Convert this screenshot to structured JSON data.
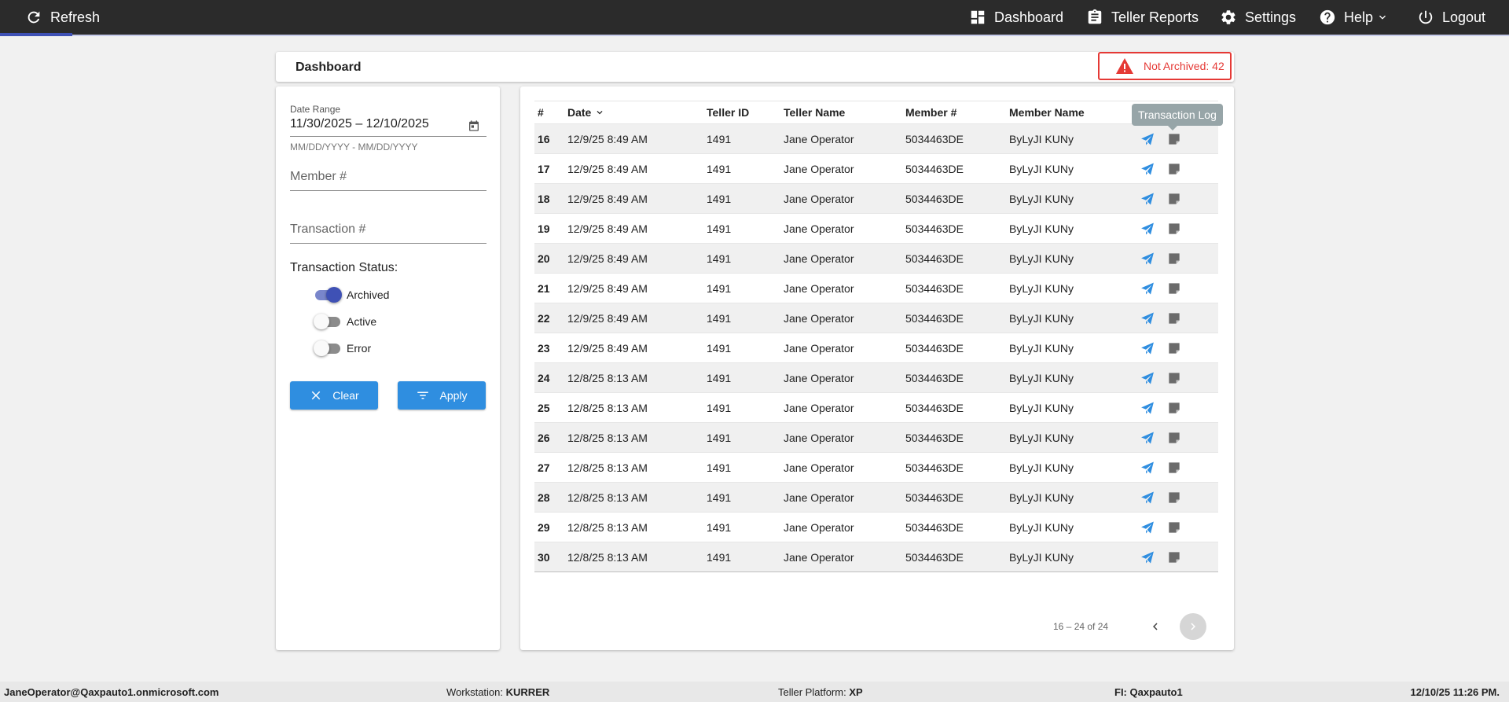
{
  "topbar": {
    "refresh_label": "Refresh",
    "nav": {
      "dashboard": "Dashboard",
      "teller_reports": "Teller Reports",
      "settings": "Settings",
      "help": "Help",
      "logout": "Logout"
    }
  },
  "header": {
    "title": "Dashboard",
    "alert_text": "Not Archived: 42",
    "alert_color": "#e53935"
  },
  "filters": {
    "date_range_label": "Date Range",
    "date_range_value": "11/30/2025 – 12/10/2025",
    "date_range_hint": "MM/DD/YYYY - MM/DD/YYYY",
    "member_placeholder": "Member #",
    "transaction_placeholder": "Transaction #",
    "status_label": "Transaction Status:",
    "statuses": [
      {
        "label": "Archived",
        "on": true
      },
      {
        "label": "Active",
        "on": false
      },
      {
        "label": "Error",
        "on": false
      }
    ],
    "clear_label": "Clear",
    "apply_label": "Apply",
    "accent": "#2f8ee0"
  },
  "table": {
    "columns": [
      "#",
      "Date",
      "Teller ID",
      "Teller Name",
      "Member #",
      "Member Name"
    ],
    "tooltip": "Transaction Log",
    "rows": [
      {
        "num": "16",
        "date": "12/9/25 8:49 AM",
        "teller_id": "1491",
        "teller_name": "Jane Operator",
        "member": "5034463DE",
        "member_name": "ByLyJI KUNy"
      },
      {
        "num": "17",
        "date": "12/9/25 8:49 AM",
        "teller_id": "1491",
        "teller_name": "Jane Operator",
        "member": "5034463DE",
        "member_name": "ByLyJI KUNy"
      },
      {
        "num": "18",
        "date": "12/9/25 8:49 AM",
        "teller_id": "1491",
        "teller_name": "Jane Operator",
        "member": "5034463DE",
        "member_name": "ByLyJI KUNy"
      },
      {
        "num": "19",
        "date": "12/9/25 8:49 AM",
        "teller_id": "1491",
        "teller_name": "Jane Operator",
        "member": "5034463DE",
        "member_name": "ByLyJI KUNy"
      },
      {
        "num": "20",
        "date": "12/9/25 8:49 AM",
        "teller_id": "1491",
        "teller_name": "Jane Operator",
        "member": "5034463DE",
        "member_name": "ByLyJI KUNy"
      },
      {
        "num": "21",
        "date": "12/9/25 8:49 AM",
        "teller_id": "1491",
        "teller_name": "Jane Operator",
        "member": "5034463DE",
        "member_name": "ByLyJI KUNy"
      },
      {
        "num": "22",
        "date": "12/9/25 8:49 AM",
        "teller_id": "1491",
        "teller_name": "Jane Operator",
        "member": "5034463DE",
        "member_name": "ByLyJI KUNy"
      },
      {
        "num": "23",
        "date": "12/9/25 8:49 AM",
        "teller_id": "1491",
        "teller_name": "Jane Operator",
        "member": "5034463DE",
        "member_name": "ByLyJI KUNy"
      },
      {
        "num": "24",
        "date": "12/8/25 8:13 AM",
        "teller_id": "1491",
        "teller_name": "Jane Operator",
        "member": "5034463DE",
        "member_name": "ByLyJI KUNy"
      },
      {
        "num": "25",
        "date": "12/8/25 8:13 AM",
        "teller_id": "1491",
        "teller_name": "Jane Operator",
        "member": "5034463DE",
        "member_name": "ByLyJI KUNy"
      },
      {
        "num": "26",
        "date": "12/8/25 8:13 AM",
        "teller_id": "1491",
        "teller_name": "Jane Operator",
        "member": "5034463DE",
        "member_name": "ByLyJI KUNy"
      },
      {
        "num": "27",
        "date": "12/8/25 8:13 AM",
        "teller_id": "1491",
        "teller_name": "Jane Operator",
        "member": "5034463DE",
        "member_name": "ByLyJI KUNy"
      },
      {
        "num": "28",
        "date": "12/8/25 8:13 AM",
        "teller_id": "1491",
        "teller_name": "Jane Operator",
        "member": "5034463DE",
        "member_name": "ByLyJI KUNy"
      },
      {
        "num": "29",
        "date": "12/8/25 8:13 AM",
        "teller_id": "1491",
        "teller_name": "Jane Operator",
        "member": "5034463DE",
        "member_name": "ByLyJI KUNy"
      },
      {
        "num": "30",
        "date": "12/8/25 8:13 AM",
        "teller_id": "1491",
        "teller_name": "Jane Operator",
        "member": "5034463DE",
        "member_name": "ByLyJI KUNy"
      }
    ],
    "pager_text": "16 – 24 of 24",
    "send_icon_color": "#2f8ee0",
    "log_icon_color": "#6b6b6b"
  },
  "statusbar": {
    "user": "JaneOperator@Qaxpauto1.onmicrosoft.com",
    "workstation_label": "Workstation:",
    "workstation_value": "KURRER",
    "platform_label": "Teller Platform:",
    "platform_value": "XP",
    "fi_label": "FI:",
    "fi_value": "Qaxpauto1",
    "datetime": "12/10/25 11:26 PM."
  },
  "icons": [
    "refresh-icon",
    "dashboard-icon",
    "clipboard-icon",
    "gear-icon",
    "help-icon",
    "chevron-down-icon",
    "power-icon",
    "warning-icon",
    "calendar-icon",
    "close-icon",
    "filter-icon",
    "send-icon",
    "note-icon",
    "chevron-left-icon",
    "chevron-right-icon"
  ]
}
